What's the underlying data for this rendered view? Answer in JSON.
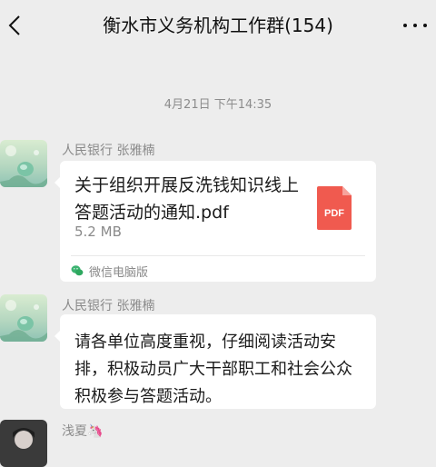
{
  "header": {
    "title": "衡水市义务机构工作群(154)",
    "back_icon": "chevron-left-icon",
    "more_icon": "ellipsis-icon"
  },
  "timestamp": "4月21日 下午14:35",
  "messages": [
    {
      "sender": "人民银行 张雅楠",
      "type": "file",
      "file": {
        "name": "关于组织开展反洗钱知识线上答题活动的通知.pdf",
        "size": "5.2 MB",
        "icon": "pdf-icon",
        "icon_label": "PDF",
        "icon_color": "#f05a4f",
        "source": "微信电脑版",
        "source_icon": "wechat-icon"
      }
    },
    {
      "sender": "人民银行 张雅楠",
      "type": "text",
      "text": "请各单位高度重视，仔细阅读活动安排，积极动员广大干部职工和社会公众积极参与答题活动。"
    },
    {
      "sender": "浅夏🦄",
      "type": "partial"
    }
  ]
}
